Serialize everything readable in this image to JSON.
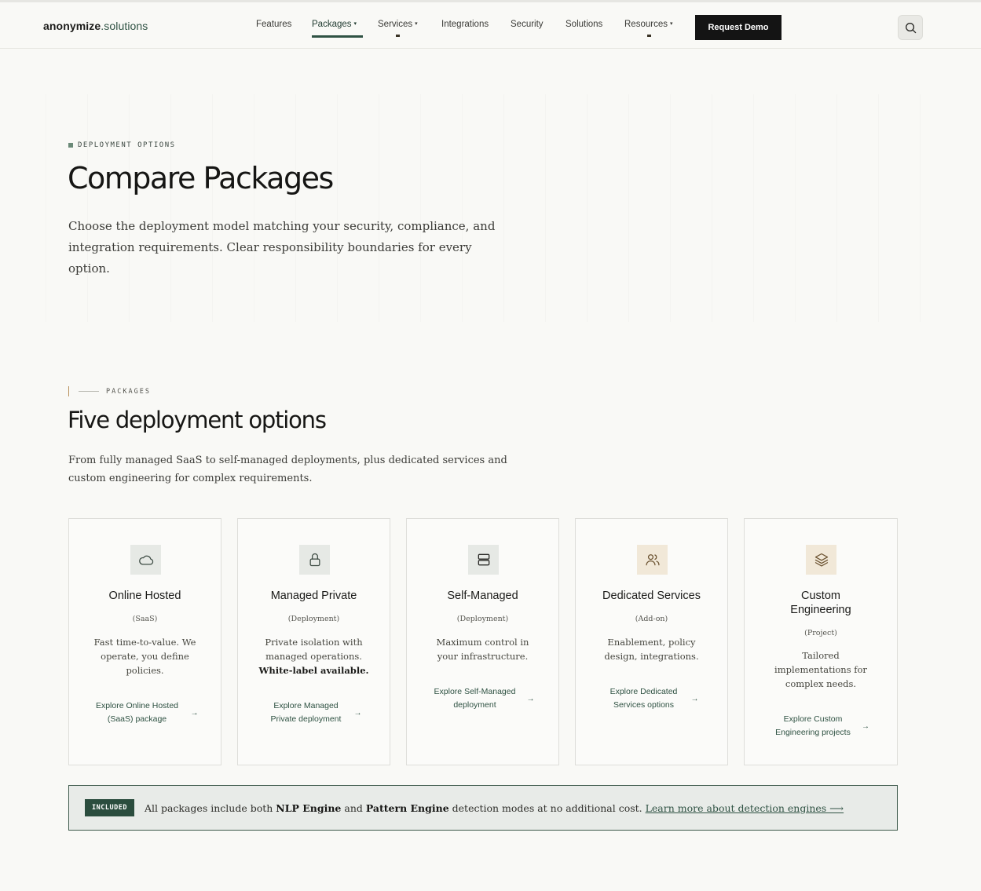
{
  "header": {
    "logo_main": "anonymize",
    "logo_suffix": ".solutions",
    "nav": [
      {
        "label": "Features"
      },
      {
        "label": "Packages",
        "caret": "▾",
        "active": true
      },
      {
        "label": "Services",
        "caret": "▾"
      },
      {
        "label": "Integrations"
      },
      {
        "label": "Security"
      },
      {
        "label": "Solutions"
      },
      {
        "label": "Resources",
        "caret": "▾"
      }
    ],
    "cta_label": "Request Demo",
    "search_icon": "search-icon"
  },
  "hero": {
    "eyebrow": "DEPLOYMENT OPTIONS",
    "title": "Compare Packages",
    "subtitle": "Choose the deployment model matching your security, compliance, and integration requirements. Clear responsibility boundaries for every option."
  },
  "packages": {
    "eyebrow": "PACKAGES",
    "title": "Five deployment options",
    "subtitle": "From fully managed SaaS to self-managed deployments, plus dedicated services and custom engineering for complex requirements.",
    "cards": [
      {
        "icon": "cloud-icon",
        "title": "Online Hosted",
        "type": "(SaaS)",
        "desc": "Fast time-to-value. We operate, you define policies.",
        "link": "Explore Online Hosted (SaaS) package"
      },
      {
        "icon": "lock-icon",
        "title": "Managed Private",
        "type": "(Deployment)",
        "desc": "Private isolation with managed operations.",
        "desc_bold": "White-label available.",
        "link": "Explore Managed Private deployment"
      },
      {
        "icon": "server-icon",
        "title": "Self-Managed",
        "type": "(Deployment)",
        "desc": "Maximum control in your infrastructure.",
        "link": "Explore Self-Managed deployment"
      },
      {
        "icon": "users-icon",
        "title": "Dedicated Services",
        "type": "(Add-on)",
        "desc": "Enablement, policy design, integrations.",
        "link": "Explore Dedicated Services options"
      },
      {
        "icon": "layers-icon",
        "title": "Custom Engineering",
        "type": "(Project)",
        "desc": "Tailored implementations for complex needs.",
        "link": "Explore Custom Engineering projects"
      }
    ],
    "arrow": "→"
  },
  "included": {
    "badge": "INCLUDED",
    "text_1": "All packages include both ",
    "bold_1": "NLP Engine",
    "text_2": " and ",
    "bold_2": "Pattern Engine",
    "text_3": " detection modes at no additional cost. ",
    "link": "Learn more about detection engines ⟶"
  },
  "colors": {
    "accent": "#2f5243",
    "cta_bg": "#141414",
    "beige_icon_bg": "#f1e8d8",
    "green_icon_bg": "#e6e9e5"
  }
}
